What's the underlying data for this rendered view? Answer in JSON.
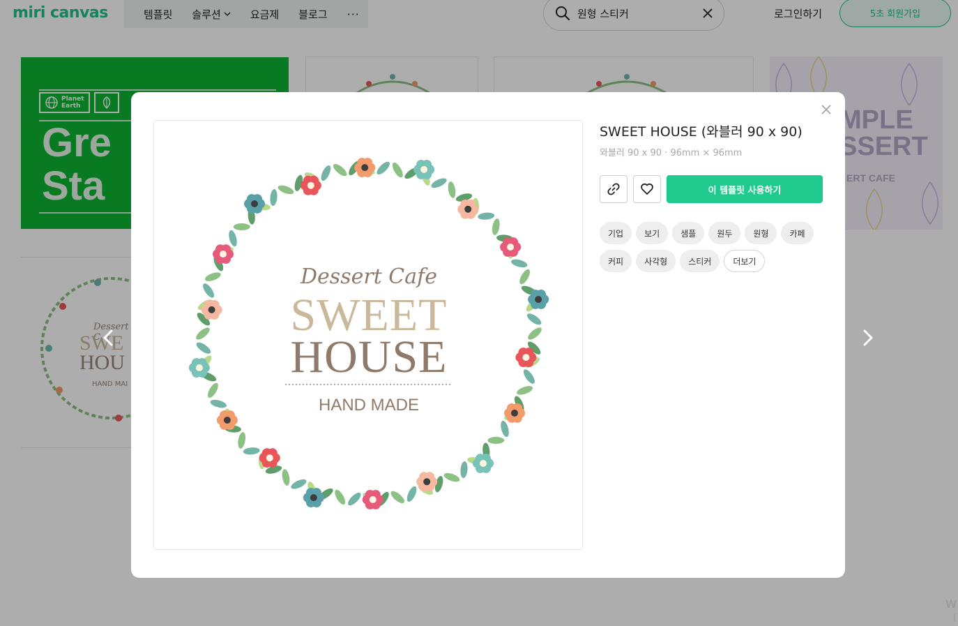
{
  "header": {
    "logo": "miri canvas",
    "nav": [
      {
        "label": "템플릿",
        "has_dropdown": false
      },
      {
        "label": "솔루션",
        "has_dropdown": true
      },
      {
        "label": "요금제",
        "has_dropdown": false
      },
      {
        "label": "블로그",
        "has_dropdown": false
      }
    ],
    "more_label": "···",
    "search": {
      "value": "원형 스티커",
      "clear_icon": "close-icon"
    },
    "login_label": "로그인하기",
    "signup_label": "5초 회원가입"
  },
  "background": {
    "green_card": {
      "badge1": "Planet\nEarth",
      "title_line1": "Gre",
      "title_line2": "Sta"
    },
    "sample_card": {
      "line1": "MPLE",
      "line2": "SSERT",
      "line3": "ERT CAFE"
    },
    "wreath_card": {
      "script": "Dessert C",
      "line1": "SWE",
      "line2": "HOU",
      "line3": "HAND MAI"
    },
    "corner_text": [
      "W",
      "["
    ]
  },
  "modal": {
    "title": "SWEET HOUSE (와블러 90 x 90)",
    "subtitle": "와블러 90 x 90 · 96mm × 96mm",
    "use_button_label": "이 템플릿 사용하기",
    "tags": [
      "기업",
      "보기",
      "샘플",
      "원두",
      "원형",
      "카페",
      "커피",
      "사각형",
      "스티커"
    ],
    "more_tags_label": "더보기",
    "preview": {
      "script": "Dessert Cafe",
      "line1": "SWEET",
      "line2": "HOUSE",
      "line3": "HAND MADE"
    }
  },
  "colors": {
    "brand": "#1fc287",
    "use_button": "#20c98d",
    "green_card": "#0cb633"
  }
}
